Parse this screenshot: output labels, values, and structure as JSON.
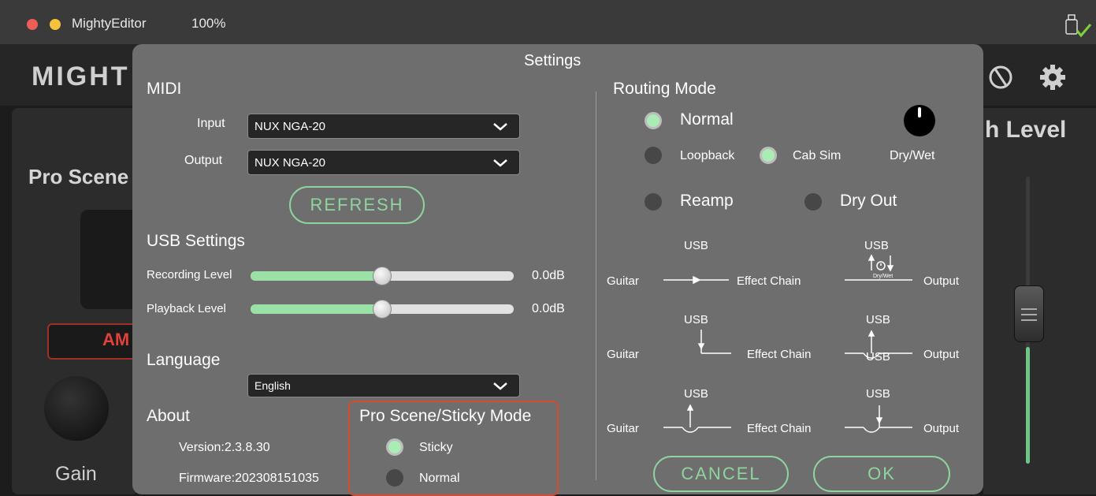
{
  "titlebar": {
    "app_name": "MightyEditor",
    "zoom": "100%"
  },
  "background": {
    "logo": "MIGHT",
    "pro_scene_label": "Pro Scene",
    "amp_label": "AM",
    "gain_label": "Gain",
    "level_label": "h Level"
  },
  "settings": {
    "title": "Settings",
    "midi": {
      "heading": "MIDI",
      "input_label": "Input",
      "input_value": "NUX NGA-20",
      "output_label": "Output",
      "output_value": "NUX NGA-20",
      "refresh": "REFRESH"
    },
    "usb": {
      "heading": "USB Settings",
      "recording_label": "Recording Level",
      "recording_value": "0.0dB",
      "recording_level": 0.5,
      "playback_label": "Playback Level",
      "playback_value": "0.0dB",
      "playback_level": 0.5
    },
    "language": {
      "heading": "Language",
      "value": "English"
    },
    "about": {
      "heading": "About",
      "version": "Version:2.3.8.30",
      "firmware": "Firmware:202308151035"
    },
    "sticky_mode": {
      "heading": "Pro Scene/Sticky Mode",
      "sticky": "Sticky",
      "normal": "Normal",
      "selected": "Sticky"
    },
    "routing": {
      "heading": "Routing Mode",
      "normal": "Normal",
      "loopback": "Loopback",
      "cab_sim": "Cab Sim",
      "dry_wet": "Dry/Wet",
      "reamp": "Reamp",
      "dry_out": "Dry Out",
      "selected": "Normal",
      "cab_sim_on": true,
      "diagram": {
        "usb": "USB",
        "guitar": "Guitar",
        "effect_chain": "Effect Chain",
        "output": "Output",
        "dry_wet_small": "Dry/Wet"
      }
    },
    "cancel": "CANCEL",
    "ok": "OK"
  },
  "colors": {
    "accent": "#8fd49f",
    "modal_bg": "#6e6e6e",
    "highlight_border": "#d64a2e"
  }
}
